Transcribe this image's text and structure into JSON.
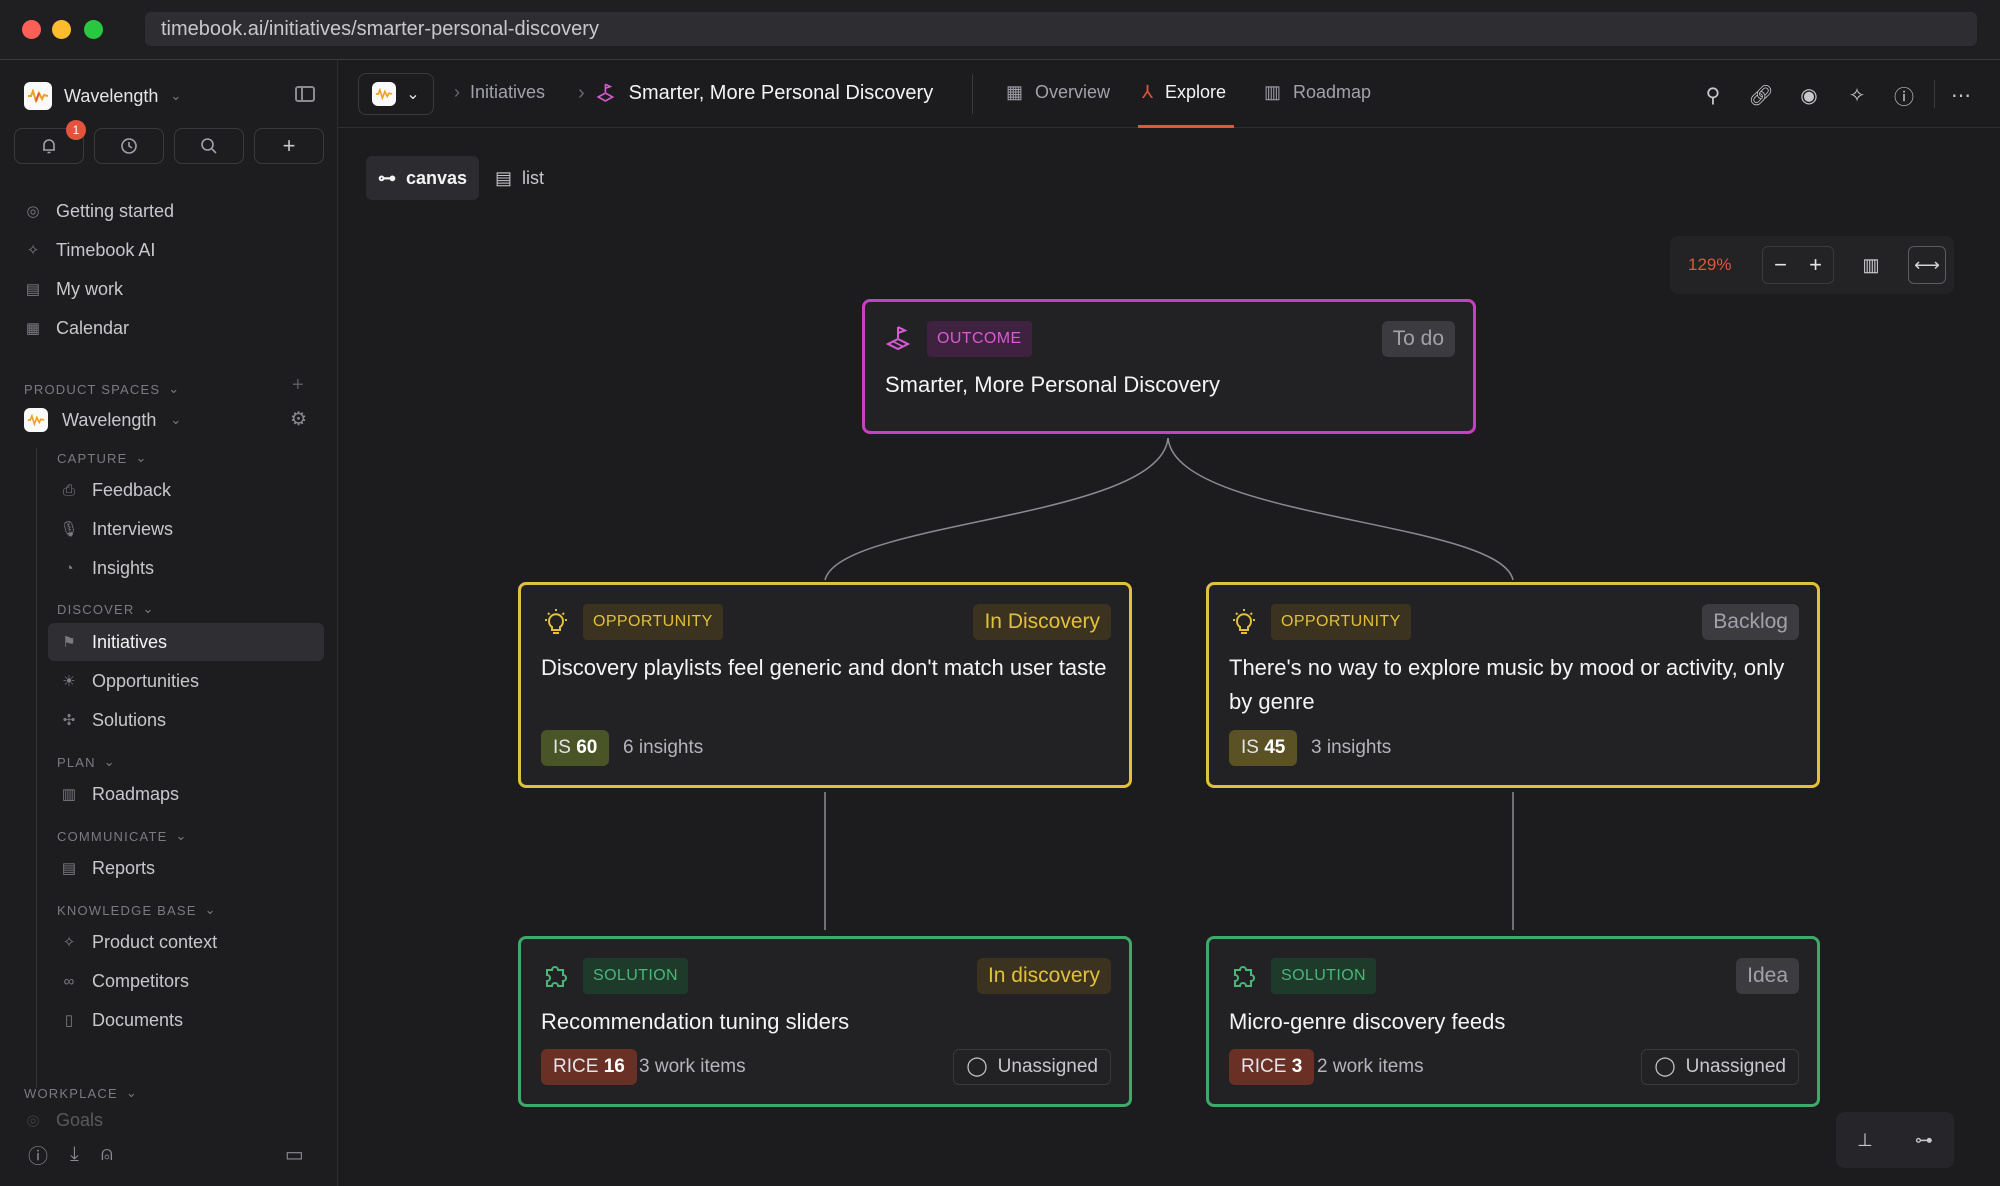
{
  "browser": {
    "url": "timebook.ai/initiatives/smarter-personal-discovery"
  },
  "sidebar": {
    "workspace": "Wavelength",
    "notification_count": "1",
    "nav": [
      {
        "label": "Getting started",
        "icon": "compass-icon"
      },
      {
        "label": "Timebook AI",
        "icon": "sparkle-icon"
      },
      {
        "label": "My work",
        "icon": "clipboard-icon"
      },
      {
        "label": "Calendar",
        "icon": "calendar-icon"
      }
    ],
    "product_spaces_label": "PRODUCT SPACES",
    "space_name": "Wavelength",
    "capture_label": "CAPTURE",
    "capture": [
      {
        "label": "Feedback"
      },
      {
        "label": "Interviews"
      },
      {
        "label": "Insights"
      }
    ],
    "discover_label": "DISCOVER",
    "discover": [
      {
        "label": "Initiatives"
      },
      {
        "label": "Opportunities"
      },
      {
        "label": "Solutions"
      }
    ],
    "plan_label": "PLAN",
    "plan": [
      {
        "label": "Roadmaps"
      }
    ],
    "communicate_label": "COMMUNICATE",
    "communicate": [
      {
        "label": "Reports"
      }
    ],
    "knowledge_label": "KNOWLEDGE BASE",
    "knowledge": [
      {
        "label": "Product context"
      },
      {
        "label": "Competitors"
      },
      {
        "label": "Documents"
      }
    ],
    "workplace_label": "WORKPLACE",
    "workplace_partial": "Goals"
  },
  "topbar": {
    "crumb_initiatives": "Initiatives",
    "crumb_title": "Smarter, More Personal Discovery",
    "tabs": [
      {
        "label": "Overview"
      },
      {
        "label": "Explore"
      },
      {
        "label": "Roadmap"
      }
    ]
  },
  "views": {
    "canvas": "canvas",
    "list": "list"
  },
  "zoom": {
    "level": "129%"
  },
  "cards": {
    "outcome": {
      "type": "OUTCOME",
      "status": "To do",
      "title": "Smarter, More Personal Discovery"
    },
    "opp1": {
      "type": "OPPORTUNITY",
      "status": "In Discovery",
      "title": "Discovery playlists feel generic and don't match user taste",
      "score_label": "IS",
      "score": "60",
      "insights": "6 insights"
    },
    "opp2": {
      "type": "OPPORTUNITY",
      "status": "Backlog",
      "title": "There's no way to explore music by mood or activity, only by genre",
      "score_label": "IS",
      "score": "45",
      "insights": "3 insights"
    },
    "sol1": {
      "type": "SOLUTION",
      "status": "In discovery",
      "title": "Recommendation tuning sliders",
      "score_label": "RICE",
      "score": "16",
      "work_items": "3 work items",
      "assignee": "Unassigned"
    },
    "sol2": {
      "type": "SOLUTION",
      "status": "Idea",
      "title": "Micro-genre discovery feeds",
      "score_label": "RICE",
      "score": "3",
      "work_items": "2 work items",
      "assignee": "Unassigned"
    }
  },
  "colors": {
    "accent": "#e5533d",
    "outcome": "#c640c3",
    "opportunity": "#e1c03a",
    "solution": "#3fa86b"
  }
}
